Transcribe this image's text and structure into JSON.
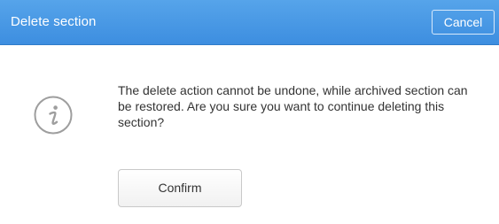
{
  "dialog": {
    "title": "Delete section",
    "cancel_label": "Cancel",
    "message": "The delete action cannot be undone, while archived section can be restored. Are you sure you want to continue deleting this section?",
    "confirm_label": "Confirm",
    "icon": "info-icon"
  },
  "colors": {
    "header_bg": "#4a9ae6",
    "header_text": "#ffffff",
    "body_text": "#333333",
    "icon_stroke": "#9e9e9e",
    "button_border": "#c9c9c9"
  }
}
